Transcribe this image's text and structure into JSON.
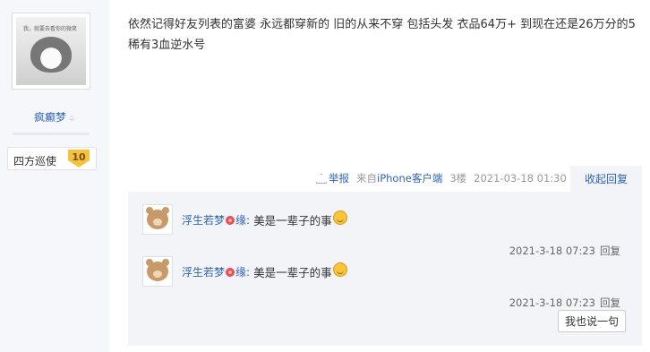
{
  "author": {
    "avatar_caption": "我，就要去看你的微笑",
    "name": "疯癫梦",
    "rank_title": "四方巡使",
    "level": "10"
  },
  "post": {
    "text": "依然记得好友列表的富婆 永远都穿新的 旧的从来不穿 包括头发 衣品64万+ 到现在还是26万分的5稀有3血逆水号",
    "meta": {
      "report_label": "举报",
      "source_prefix": "来自",
      "source_client": "iPhone客户端",
      "floor": "3楼",
      "timestamp": "2021-03-18 01:30",
      "collapse_label": "收起回复"
    }
  },
  "replies": [
    {
      "user_prefix": "浮生若梦",
      "user_suffix": "缘",
      "colon": ":",
      "text": "美是一辈子的事",
      "time": "2021-3-18 07:23",
      "reply_label": "回复"
    },
    {
      "user_prefix": "浮生若梦",
      "user_suffix": "缘",
      "colon": ":",
      "text": "美是一辈子的事",
      "time": "2021-3-18 07:23",
      "reply_label": "回复"
    }
  ],
  "actions": {
    "say_label": "我也说一句"
  },
  "icons": {
    "username_glyph": "♤"
  },
  "colors": {
    "link_blue": "#2d64b3",
    "reply_bg": "#f3f4f8",
    "left_bg": "#f6f7fa",
    "badge_gold": "#f5c33b"
  }
}
